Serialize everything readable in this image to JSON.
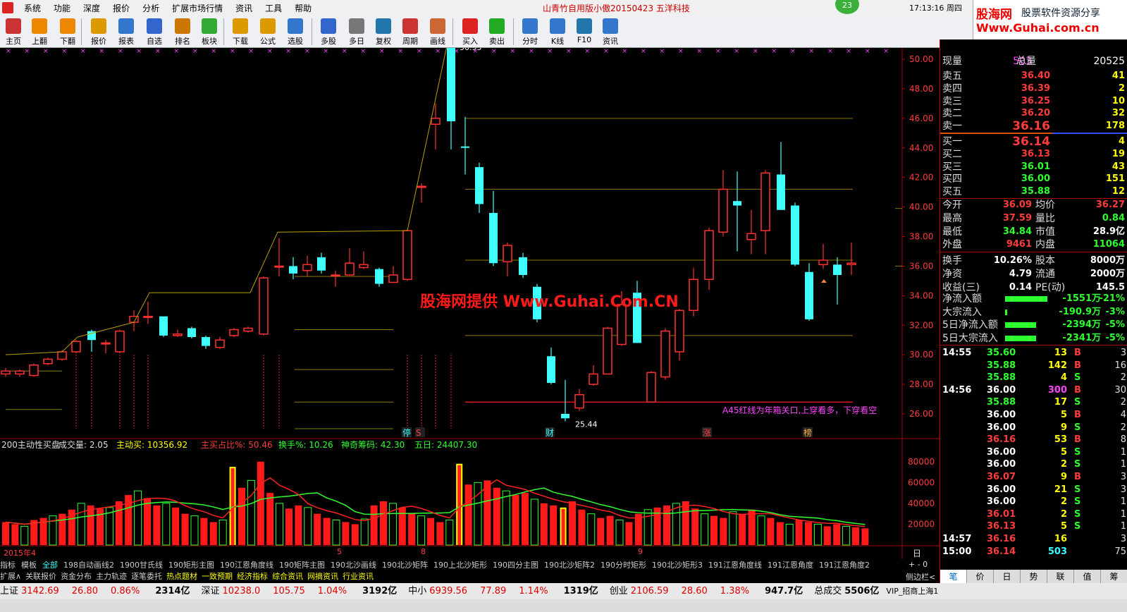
{
  "menu": {
    "items": [
      "系统",
      "功能",
      "深度",
      "报价",
      "分析",
      "扩展市场行情",
      "资讯",
      "工具",
      "帮助"
    ],
    "app_title": "山青竹自用版小傲20150423   五洋科技",
    "badge": "23",
    "clock": "17:13:16 周四"
  },
  "brand": {
    "line1": "股海网",
    "line2": "股票软件资源分享",
    "line3": "Www.Guhai.com.cn"
  },
  "toolbar": [
    "主页",
    "上翻",
    "下翻",
    "报价",
    "报表",
    "自选",
    "排名",
    "板块",
    "下载",
    "公式",
    "选股",
    "多股",
    "多日",
    "复权",
    "周期",
    "画线",
    "买入",
    "卖出",
    "分时",
    "K线",
    "F10",
    "资讯"
  ],
  "watermark": "股海网提供 Www.Guhai.Com.CN",
  "annotation": "A45红线为年箱关口,上穿看多，下穿看空",
  "price_axis": [
    "50.00",
    "48.00",
    "46.00",
    "44.00",
    "42.00",
    "40.00",
    "38.00",
    "36.00",
    "34.00",
    "32.00",
    "30.00",
    "28.00",
    "26.00"
  ],
  "vol_axis": [
    "80000",
    "60000",
    "40000",
    "20000"
  ],
  "high_label": "50.95",
  "low_label": "25.44",
  "markers": {
    "ting": "停",
    "s": "S",
    "cai": "财",
    "zhang": "涨",
    "bang": "榜"
  },
  "indicator_line": {
    "name": "200主动性买盘",
    "vol": "成交量: 2.05",
    "buy": "主动买: 10356.92",
    "buy_ratio": "主买占比%: 50.46",
    "turnover": "换手%: 10.26",
    "chip": "神奇筹码: 42.30",
    "five": "五日: 24407.30"
  },
  "dates": [
    "2015年4",
    "5",
    "8",
    "9"
  ],
  "right_axis_label": "日线",
  "quote": {
    "xianliang": "现量",
    "xianliang_v": "503",
    "zongliang": "总量",
    "zongliang_v": "20525",
    "asks": [
      {
        "l": "卖五",
        "p": "36.40",
        "v": "41"
      },
      {
        "l": "卖四",
        "p": "36.39",
        "v": "2"
      },
      {
        "l": "卖三",
        "p": "36.25",
        "v": "10"
      },
      {
        "l": "卖二",
        "p": "36.20",
        "v": "32"
      },
      {
        "l": "卖一",
        "p": "36.16",
        "v": "178"
      }
    ],
    "bids": [
      {
        "l": "买一",
        "p": "36.14",
        "v": "4"
      },
      {
        "l": "买二",
        "p": "36.13",
        "v": "19"
      },
      {
        "l": "买三",
        "p": "36.01",
        "v": "43"
      },
      {
        "l": "买四",
        "p": "36.00",
        "v": "151"
      },
      {
        "l": "买五",
        "p": "35.88",
        "v": "12"
      }
    ],
    "stats": [
      {
        "a": "今开",
        "av": "36.09",
        "b": "均价",
        "bv": "36.27",
        "ac": "red",
        "bc": "red"
      },
      {
        "a": "最高",
        "av": "37.59",
        "b": "量比",
        "bv": "0.84",
        "ac": "red",
        "bc": "grn"
      },
      {
        "a": "最低",
        "av": "34.84",
        "b": "市值",
        "bv": "28.9亿",
        "ac": "grn",
        "bc": "wht"
      },
      {
        "a": "外盘",
        "av": "9461",
        "b": "内盘",
        "bv": "11064",
        "ac": "red",
        "bc": "grn"
      },
      {
        "a": "换手",
        "av": "10.26%",
        "b": "股本",
        "bv": "8000万",
        "ac": "wht",
        "bc": "wht"
      },
      {
        "a": "净资",
        "av": "4.79",
        "b": "流通",
        "bv": "2000万",
        "ac": "wht",
        "bc": "wht"
      },
      {
        "a": "收益(三)",
        "av": "0.14",
        "b": "PE(动)",
        "bv": "145.5",
        "ac": "wht",
        "bc": "wht"
      }
    ],
    "flows": [
      {
        "l": "净流入额",
        "v": "-1551万",
        "p": "-21%",
        "w": 60
      },
      {
        "l": "大宗流入",
        "v": "-190.9万",
        "p": "-3%",
        "w": 3
      },
      {
        "l": "5日净流入额",
        "v": "-2394万",
        "p": "-5%",
        "w": 44
      },
      {
        "l": "5日大宗流入",
        "v": "-2341万",
        "p": "-5%",
        "w": 44
      }
    ]
  },
  "ticks": [
    {
      "t": "14:55",
      "p": "35.60",
      "v": "13",
      "f": "B",
      "n": "3",
      "pc": "grn"
    },
    {
      "t": "",
      "p": "35.88",
      "v": "142",
      "f": "B",
      "n": "16",
      "pc": "grn"
    },
    {
      "t": "",
      "p": "35.88",
      "v": "4",
      "f": "S",
      "n": "2",
      "pc": "grn"
    },
    {
      "t": "14:56",
      "p": "36.00",
      "v": "300",
      "f": "B",
      "n": "30",
      "pc": "wht",
      "vc": "mag"
    },
    {
      "t": "",
      "p": "35.88",
      "v": "17",
      "f": "S",
      "n": "2",
      "pc": "grn"
    },
    {
      "t": "",
      "p": "36.00",
      "v": "5",
      "f": "B",
      "n": "4",
      "pc": "wht"
    },
    {
      "t": "",
      "p": "36.00",
      "v": "9",
      "f": "S",
      "n": "2",
      "pc": "wht"
    },
    {
      "t": "",
      "p": "36.16",
      "v": "53",
      "f": "B",
      "n": "8",
      "pc": "red"
    },
    {
      "t": "",
      "p": "36.00",
      "v": "5",
      "f": "S",
      "n": "1",
      "pc": "wht"
    },
    {
      "t": "",
      "p": "36.00",
      "v": "2",
      "f": "S",
      "n": "1",
      "pc": "wht"
    },
    {
      "t": "",
      "p": "36.07",
      "v": "9",
      "f": "B",
      "n": "3",
      "pc": "red"
    },
    {
      "t": "",
      "p": "36.00",
      "v": "21",
      "f": "S",
      "n": "3",
      "pc": "wht"
    },
    {
      "t": "",
      "p": "36.00",
      "v": "2",
      "f": "S",
      "n": "1",
      "pc": "wht"
    },
    {
      "t": "",
      "p": "36.01",
      "v": "2",
      "f": "S",
      "n": "1",
      "pc": "red"
    },
    {
      "t": "",
      "p": "36.13",
      "v": "5",
      "f": "S",
      "n": "1",
      "pc": "red"
    },
    {
      "t": "14:57",
      "p": "36.16",
      "v": "16",
      "f": "",
      "n": "3",
      "pc": "red"
    },
    {
      "t": "15:00",
      "p": "36.14",
      "v": "503",
      "f": "",
      "n": "75",
      "pc": "red",
      "vc": "cyn"
    }
  ],
  "right_tabs": [
    "笔",
    "价",
    "日",
    "势",
    "联",
    "值",
    "筹"
  ],
  "tabs": [
    "指标",
    "模板",
    "全部",
    "198自动画线2",
    "1900甘氏线",
    "190矩形主图",
    "190江恩角度线",
    "190矩阵主图",
    "190北沙画线",
    "190北沙矩阵",
    "190上北沙矩形",
    "190四分主图",
    "190北沙矩阵2",
    "190分时矩形",
    "190北沙矩形3",
    "191江恩角度线",
    "191江恩角度",
    "191江恩角度2"
  ],
  "subtabs": [
    "扩展∧",
    "关联报价",
    "资金分布",
    "主力轨迹",
    "逐笔委托",
    "热点题材",
    "一致预期",
    "经济指标",
    "综合资讯",
    "网摘资讯",
    "行业资讯"
  ],
  "side": {
    "pm": "+ - 0",
    "edge": "侧边栏<"
  },
  "status": [
    {
      "n": "上证",
      "a": "3142.69",
      "b": "26.80",
      "c": "0.86%",
      "d": "2314亿"
    },
    {
      "n": "深证",
      "a": "10238.0",
      "b": "105.75",
      "c": "1.04%",
      "d": "3192亿"
    },
    {
      "n": "中小",
      "a": "6939.56",
      "b": "77.89",
      "c": "1.14%",
      "d": "1319亿"
    },
    {
      "n": "创业",
      "a": "2106.59",
      "b": "28.60",
      "c": "1.38%",
      "d": "947.7亿"
    }
  ],
  "status_total": "总成交",
  "status_total_v": "5506亿",
  "status_vip": "VIP_招商上海1",
  "colors": {
    "up": "#ff2020",
    "down": "#40ffff",
    "grid": "#800000",
    "ma": "#b8a000"
  }
}
